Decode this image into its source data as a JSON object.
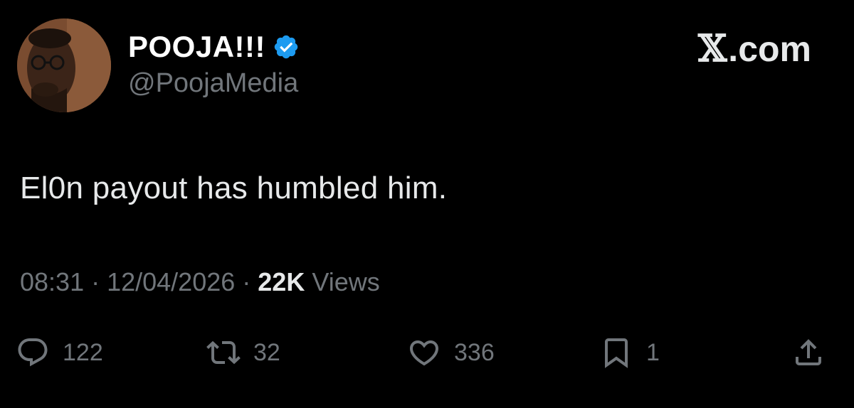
{
  "author": {
    "display_name": "POOJA!!!",
    "handle": "@PoojaMedia",
    "verified": true,
    "verified_color": "#1d9bf0"
  },
  "brand": {
    "label": ".com",
    "logo_glyph": "𝕏"
  },
  "tweet": {
    "text": "El0n payout has humbled him."
  },
  "meta": {
    "time": "08:31",
    "separator": "·",
    "date": "12/04/2026",
    "views_count": "22K",
    "views_label": "Views"
  },
  "actions": {
    "reply": {
      "icon": "reply-icon",
      "count": "122"
    },
    "retweet": {
      "icon": "retweet-icon",
      "count": "32"
    },
    "like": {
      "icon": "heart-icon",
      "count": "336"
    },
    "bookmark": {
      "icon": "bookmark-icon",
      "count": "1"
    },
    "share": {
      "icon": "share-icon"
    }
  },
  "colors": {
    "background": "#000000",
    "primary_text": "#e7e9ea",
    "secondary_text": "#71767b",
    "accent": "#1d9bf0"
  }
}
